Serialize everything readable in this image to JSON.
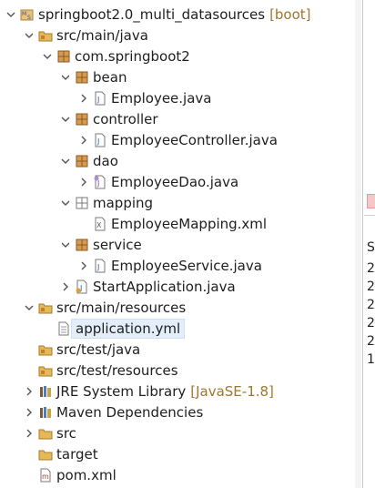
{
  "tree": [
    {
      "label": "springboot2.0_multi_datasources",
      "deco": "[boot]",
      "icon": "maven-project-icon",
      "expanded": true
    },
    {
      "label": "src/main/java",
      "icon": "source-folder-icon",
      "expanded": true
    },
    {
      "label": "com.springboot2",
      "icon": "package-icon",
      "expanded": true
    },
    {
      "label": "bean",
      "icon": "package-icon",
      "expanded": true
    },
    {
      "label": "Employee.java",
      "icon": "java-file-icon",
      "expanded": false
    },
    {
      "label": "controller",
      "icon": "package-icon",
      "expanded": true
    },
    {
      "label": "EmployeeController.java",
      "icon": "java-file-icon",
      "expanded": false
    },
    {
      "label": "dao",
      "icon": "package-icon",
      "expanded": true
    },
    {
      "label": "EmployeeDao.java",
      "icon": "java-interface-file-icon",
      "expanded": false
    },
    {
      "label": "mapping",
      "icon": "empty-package-icon",
      "expanded": true
    },
    {
      "label": "EmployeeMapping.xml",
      "icon": "xml-file-icon"
    },
    {
      "label": "service",
      "icon": "package-icon",
      "expanded": true
    },
    {
      "label": "EmployeeService.java",
      "icon": "java-file-icon",
      "expanded": false
    },
    {
      "label": "StartApplication.java",
      "icon": "java-main-file-icon",
      "expanded": false
    },
    {
      "label": "src/main/resources",
      "icon": "source-folder-icon",
      "expanded": true
    },
    {
      "label": "application.yml",
      "icon": "text-file-icon",
      "selected": true
    },
    {
      "label": "src/test/java",
      "icon": "source-folder-icon"
    },
    {
      "label": "src/test/resources",
      "icon": "source-folder-icon"
    },
    {
      "label": "JRE System Library",
      "deco": "[JavaSE-1.8]",
      "icon": "library-icon",
      "expanded": false
    },
    {
      "label": "Maven Dependencies",
      "icon": "library-icon",
      "expanded": false
    },
    {
      "label": "src",
      "icon": "folder-icon",
      "expanded": false
    },
    {
      "label": "target",
      "icon": "folder-icon"
    },
    {
      "label": "pom.xml",
      "icon": "maven-pom-icon"
    }
  ],
  "side_panel": {
    "header": "S",
    "values": [
      "2",
      "2",
      "2",
      "2",
      "2",
      "1"
    ]
  },
  "colors": {
    "selection": "#e4eefa",
    "decoration": "#a0762e",
    "package": "#b9722f",
    "folder": "#e5b85a"
  }
}
